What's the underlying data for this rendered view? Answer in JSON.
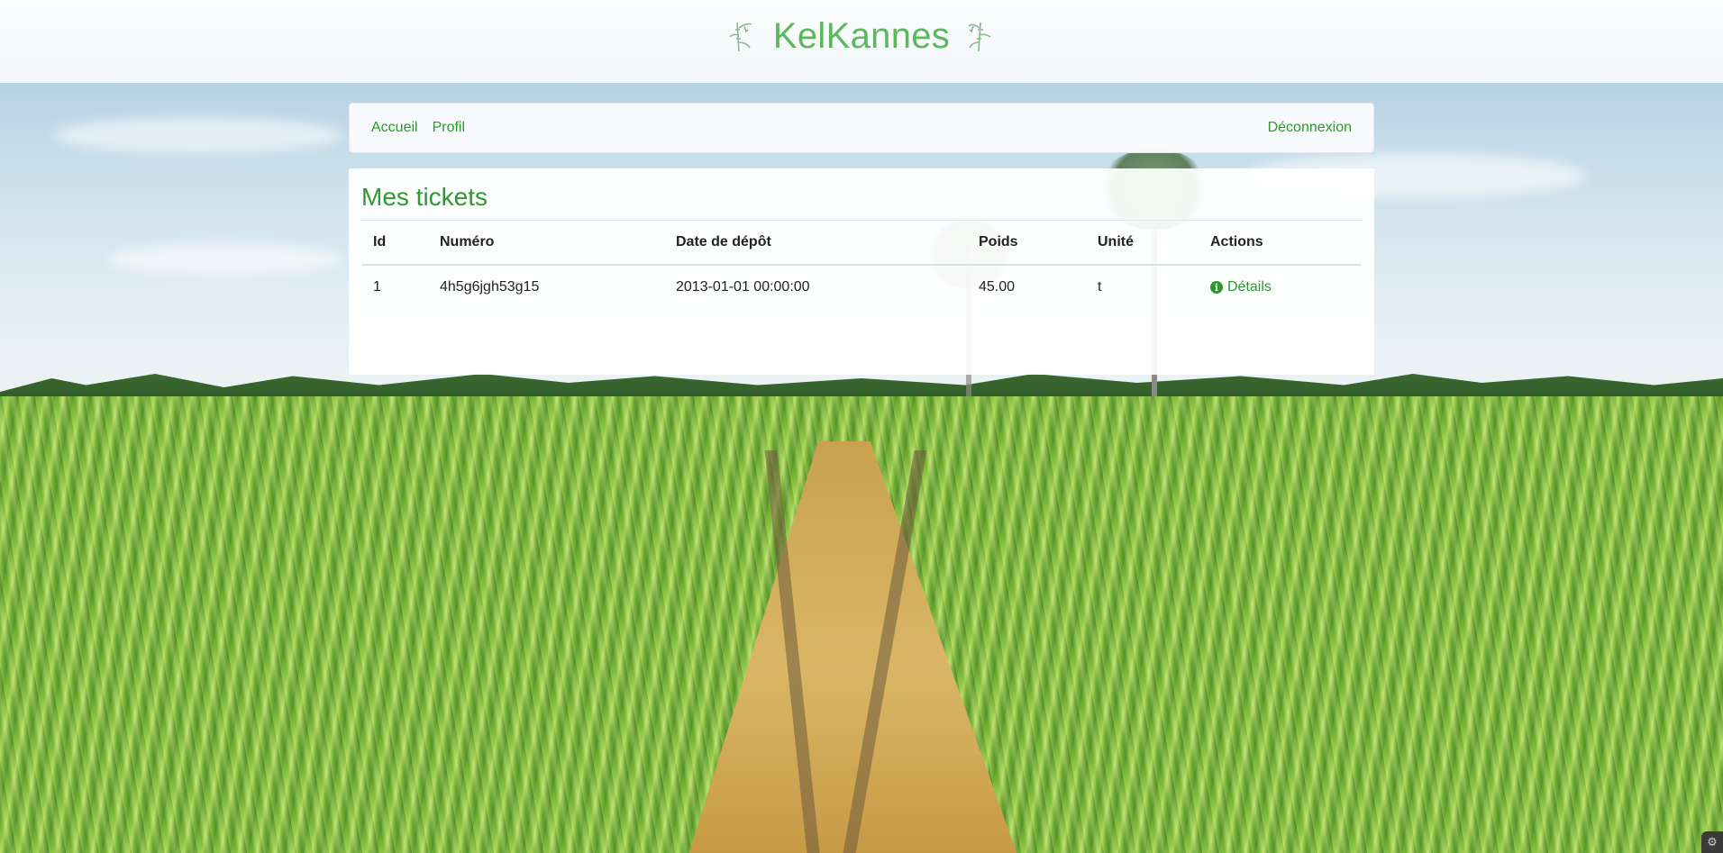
{
  "app": {
    "brand_title": "KelKannes"
  },
  "nav": {
    "home": "Accueil",
    "profile": "Profil",
    "logout": "Déconnexion"
  },
  "main": {
    "title": "Mes tickets",
    "table": {
      "headers": [
        "Id",
        "Numéro",
        "Date de dépôt",
        "Poids",
        "Unité",
        "Actions"
      ],
      "rows": [
        {
          "id": "1",
          "numero": "4h5g6jgh53g15",
          "date": "2013-01-01 00:00:00",
          "poids": "45.00",
          "unite": "t",
          "action_label": "Détails"
        }
      ]
    }
  },
  "icons": {
    "brand_left": "bamboo-icon",
    "brand_right": "bamboo-icon",
    "details": "info-circle-icon",
    "corner": "toolbar-toggle-icon"
  },
  "colors": {
    "brand": "#5cb85c",
    "link": "#2a9a2a"
  }
}
